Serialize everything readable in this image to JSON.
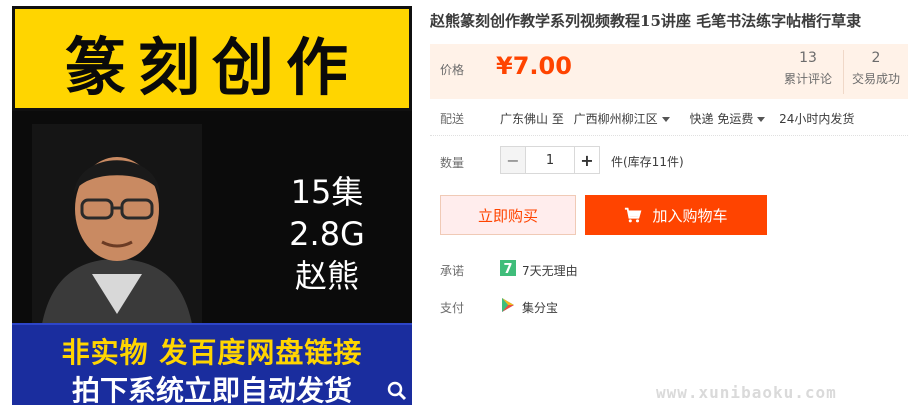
{
  "product_image": {
    "heading": "篆刻创作",
    "count_lines": [
      "15集",
      "2.8G",
      "赵熊"
    ],
    "banner_line1": "非实物 发百度网盘链接",
    "banner_line2": "拍下系统立即自动发货"
  },
  "title": "赵熊篆刻创作教学系列视频教程15讲座 毛笔书法练字帖楷行草隶",
  "price": {
    "label": "价格",
    "value": "¥7.00",
    "reviews_count": "13",
    "reviews_label": "累计评论",
    "sales_count": "2",
    "sales_label": "交易成功"
  },
  "shipping": {
    "label": "配送",
    "from": "广东佛山 至",
    "to": "广西柳州柳江区",
    "method": "快递 免运费",
    "time": "24小时内发货"
  },
  "quantity": {
    "label": "数量",
    "value": "1",
    "minus": "−",
    "plus": "+",
    "stock": "件(库存11件)"
  },
  "actions": {
    "buy_now": "立即购买",
    "add_to_cart": "加入购物车"
  },
  "promise": {
    "label": "承诺",
    "text": "7天无理由",
    "icon_text": "7"
  },
  "payment": {
    "label": "支付",
    "text": "集分宝"
  },
  "watermark": "www.xunibaoku.com",
  "colors": {
    "accent": "#ff4400",
    "price_bg": "#fff2e8",
    "badge_green": "#3fbd7a"
  }
}
